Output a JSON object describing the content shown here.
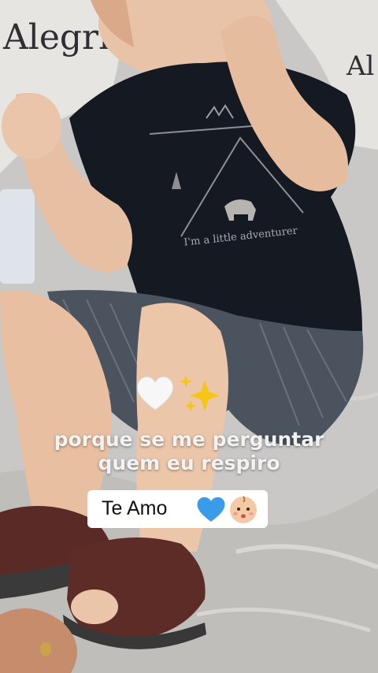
{
  "background": {
    "pillow_text": "Alegria",
    "shirt_text": "I'm a little adventurer"
  },
  "stickers": {
    "emojis": [
      "white-heart",
      "sparkles"
    ],
    "caption_line_1": "porque se me perguntar",
    "caption_line_2": "quem eu respiro",
    "pill_text": "Te Amo",
    "pill_emojis": [
      "blue-heart",
      "baby-face"
    ]
  },
  "colors": {
    "pill_bg": "#ffffff",
    "caption_text": "#f2f2f2",
    "blue_heart": "#3a9be8",
    "sparkle": "#f5c518",
    "shirt": "#141820"
  }
}
